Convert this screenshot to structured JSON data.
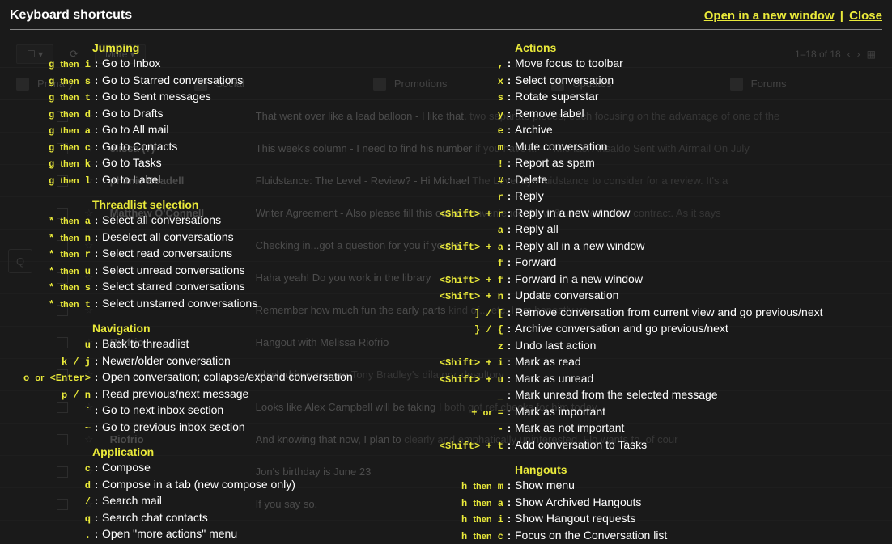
{
  "header": {
    "title": "Keyboard shortcuts",
    "open_new_window": "Open in a new window",
    "close": "Close"
  },
  "bg": {
    "more_btn": "More",
    "count": "1–18 of 18",
    "tabs": [
      "Primary",
      "Social",
      "Promotions",
      "Updates",
      "Forums"
    ],
    "rows": [
      {
        "sender": "",
        "subject": "That went over like a lead balloon - I like that.",
        "rest": "two separate pieces, each focusing on the advantage of one of the"
      },
      {
        "sender": "elissa (7)",
        "subject": "This week's column - I need to find his number",
        "rest": "if you have it. — Michael Ansaldo Sent with Airmail On July"
      },
      {
        "sender": "phanie Beadell",
        "subject": "Fluidstance: The Level - Review? - Hi Michael",
        "rest": "The Level by Fluidstance to consider for a review. It's a"
      },
      {
        "sender": "Matthew O'Connell",
        "subject": "Writer Agreement - Also please fill this out at",
        "rest": "convenience. New & updated writer contract. As it says"
      },
      {
        "sender": "",
        "subject": "Checking in...got a question for you if you're",
        "rest": ""
      },
      {
        "sender": "",
        "subject": "Haha yeah! Do you work in the library",
        "rest": ""
      },
      {
        "sender": "",
        "subject": "Remember how much fun the early parts",
        "rest": "kind of... etc. I am honestly ve"
      },
      {
        "sender": "Riofrio",
        "subject": "Hangout with Melissa Riofrio",
        "rest": ""
      },
      {
        "sender": "",
        "subject": "which drives me cra",
        "rest": "Tony Bradley's dilatory, desultory"
      },
      {
        "sender": "",
        "subject": "Looks like Alex Campbell will be taking",
        "rest": "I both got ref checks for him today."
      },
      {
        "sender": "Riofrio",
        "subject": "And knowing that now, I plan to",
        "rest": "clearly and emphatically uninterested. Flo wants to, of cour"
      },
      {
        "sender": "",
        "subject": "Jon's birthday is June 23",
        "rest": ""
      },
      {
        "sender": "",
        "subject": "If you say so.",
        "rest": ""
      }
    ]
  },
  "left": [
    {
      "type": "section",
      "label": "Jumping"
    },
    {
      "type": "row",
      "key": "g <span class='nonmono'>then</span> i",
      "desc": "Go to Inbox"
    },
    {
      "type": "row",
      "key": "g <span class='nonmono'>then</span> s",
      "desc": "Go to Starred conversations"
    },
    {
      "type": "row",
      "key": "g <span class='nonmono'>then</span> t",
      "desc": "Go to Sent messages"
    },
    {
      "type": "row",
      "key": "g <span class='nonmono'>then</span> d",
      "desc": "Go to Drafts"
    },
    {
      "type": "row",
      "key": "g <span class='nonmono'>then</span> a",
      "desc": "Go to All mail"
    },
    {
      "type": "row",
      "key": "g <span class='nonmono'>then</span> c",
      "desc": "Go to Contacts"
    },
    {
      "type": "row",
      "key": "g <span class='nonmono'>then</span> k",
      "desc": "Go to Tasks"
    },
    {
      "type": "row",
      "key": "g <span class='nonmono'>then</span> l",
      "desc": "Go to Label"
    },
    {
      "type": "spacer"
    },
    {
      "type": "section",
      "label": "Threadlist selection"
    },
    {
      "type": "row",
      "key": "* <span class='nonmono'>then</span> a",
      "desc": "Select all conversations"
    },
    {
      "type": "row",
      "key": "* <span class='nonmono'>then</span> n",
      "desc": "Deselect all conversations"
    },
    {
      "type": "row",
      "key": "* <span class='nonmono'>then</span> r",
      "desc": "Select read conversations"
    },
    {
      "type": "row",
      "key": "* <span class='nonmono'>then</span> u",
      "desc": "Select unread conversations"
    },
    {
      "type": "row",
      "key": "* <span class='nonmono'>then</span> s",
      "desc": "Select starred conversations"
    },
    {
      "type": "row",
      "key": "* <span class='nonmono'>then</span> t",
      "desc": "Select unstarred conversations"
    },
    {
      "type": "spacer"
    },
    {
      "type": "section",
      "label": "Navigation"
    },
    {
      "type": "row",
      "key": "u",
      "desc": "Back to threadlist"
    },
    {
      "type": "row",
      "key": "k / j",
      "desc": "Newer/older conversation"
    },
    {
      "type": "row",
      "key": "o <span class='nonmono'>or</span> &lt;Enter&gt;",
      "desc": "Open conversation; collapse/expand conversation"
    },
    {
      "type": "row",
      "key": "p / n",
      "desc": "Read previous/next message"
    },
    {
      "type": "row",
      "key": "`",
      "desc": "Go to next inbox section"
    },
    {
      "type": "row",
      "key": "~",
      "desc": "Go to previous inbox section"
    },
    {
      "type": "spacer"
    },
    {
      "type": "section",
      "label": "Application"
    },
    {
      "type": "row",
      "key": "c",
      "desc": "Compose"
    },
    {
      "type": "row",
      "key": "d",
      "desc": "Compose in a tab (new compose only)"
    },
    {
      "type": "row",
      "key": "/",
      "desc": "Search mail"
    },
    {
      "type": "row",
      "key": "q",
      "desc": "Search chat contacts"
    },
    {
      "type": "row",
      "key": ".",
      "desc": "Open \"more actions\" menu"
    }
  ],
  "right": [
    {
      "type": "section",
      "label": "Actions"
    },
    {
      "type": "row",
      "key": ",",
      "desc": "Move focus to toolbar"
    },
    {
      "type": "row",
      "key": "x",
      "desc": "Select conversation"
    },
    {
      "type": "row",
      "key": "s",
      "desc": "Rotate superstar"
    },
    {
      "type": "row",
      "key": "y",
      "desc": "Remove label"
    },
    {
      "type": "row",
      "key": "e",
      "desc": "Archive"
    },
    {
      "type": "row",
      "key": "m",
      "desc": "Mute conversation"
    },
    {
      "type": "row",
      "key": "!",
      "desc": "Report as spam"
    },
    {
      "type": "row",
      "key": "#",
      "desc": "Delete"
    },
    {
      "type": "row",
      "key": "r",
      "desc": "Reply"
    },
    {
      "type": "row",
      "key": "&lt;Shift&gt; + r",
      "desc": "Reply in a new window"
    },
    {
      "type": "row",
      "key": "a",
      "desc": "Reply all"
    },
    {
      "type": "row",
      "key": "&lt;Shift&gt; + a",
      "desc": "Reply all in a new window"
    },
    {
      "type": "row",
      "key": "f",
      "desc": "Forward"
    },
    {
      "type": "row",
      "key": "&lt;Shift&gt; + f",
      "desc": "Forward in a new window"
    },
    {
      "type": "row",
      "key": "&lt;Shift&gt; + n",
      "desc": "Update conversation"
    },
    {
      "type": "row",
      "key": "] / [",
      "desc": "Remove conversation from current view and go previous/next"
    },
    {
      "type": "row",
      "key": "} / {",
      "desc": "Archive conversation and go previous/next"
    },
    {
      "type": "row",
      "key": "z",
      "desc": "Undo last action"
    },
    {
      "type": "row",
      "key": "&lt;Shift&gt; + i",
      "desc": "Mark as read"
    },
    {
      "type": "row",
      "key": "&lt;Shift&gt; + u",
      "desc": "Mark as unread"
    },
    {
      "type": "row",
      "key": "_",
      "desc": "Mark unread from the selected message"
    },
    {
      "type": "row",
      "key": "+ <span class='nonmono'>or</span> =",
      "desc": "Mark as important"
    },
    {
      "type": "row",
      "key": "-",
      "desc": "Mark as not important"
    },
    {
      "type": "row",
      "key": "&lt;Shift&gt; + t",
      "desc": "Add conversation to Tasks"
    },
    {
      "type": "spacer"
    },
    {
      "type": "section",
      "label": "Hangouts"
    },
    {
      "type": "row",
      "key": "h <span class='nonmono'>then</span> m",
      "desc": "Show menu"
    },
    {
      "type": "row",
      "key": "h <span class='nonmono'>then</span> a",
      "desc": "Show Archived Hangouts"
    },
    {
      "type": "row",
      "key": "h <span class='nonmono'>then</span> i",
      "desc": "Show Hangout requests"
    },
    {
      "type": "row",
      "key": "h <span class='nonmono'>then</span> c",
      "desc": "Focus on the Conversation list"
    }
  ]
}
